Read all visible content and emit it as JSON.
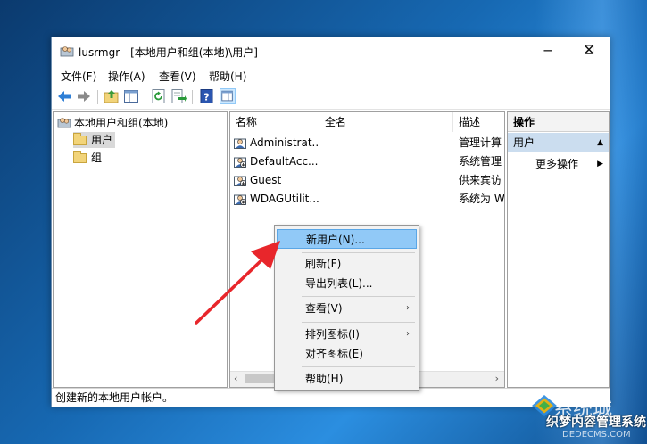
{
  "window": {
    "title": "lusrmgr - [本地用户和组(本地)\\用户]",
    "controls": {
      "minimize": "─",
      "maximize": "☐",
      "close": "✕"
    }
  },
  "menubar": [
    "文件(F)",
    "操作(A)",
    "查看(V)",
    "帮助(H)"
  ],
  "toolbar": [
    "back-arrow-icon",
    "forward-arrow-icon",
    "up-folder-icon",
    "show-hide-tree-icon",
    "refresh-icon",
    "export-list-icon",
    "help-icon",
    "properties-pane-icon"
  ],
  "tree": {
    "root": "本地用户和组(本地)",
    "children": [
      "用户",
      "组"
    ]
  },
  "list": {
    "columns": [
      "名称",
      "全名",
      "描述"
    ],
    "rows": [
      {
        "name": "Administrat...",
        "fullname": "",
        "desc": "管理计算"
      },
      {
        "name": "DefaultAcc...",
        "fullname": "",
        "desc": "系统管理"
      },
      {
        "name": "Guest",
        "fullname": "",
        "desc": "供来宾访"
      },
      {
        "name": "WDAGUtilit...",
        "fullname": "",
        "desc": "系统为 W"
      }
    ]
  },
  "actions": {
    "header": "操作",
    "section": "用户",
    "more": "更多操作"
  },
  "status": "创建新的本地用户帐户。",
  "context_menu": {
    "items": [
      "新用户(N)...",
      "刷新(F)",
      "导出列表(L)...",
      "查看(V)",
      "排列图标(I)",
      "对齐图标(E)",
      "帮助(H)"
    ],
    "submenu_arrow": "›"
  },
  "watermark": {
    "line1": "系统城",
    "line2": "织梦内容管理系统",
    "line3": "DEDECMS.COM"
  },
  "colors": {
    "selection": "#cce8ff",
    "highlight": "#91c9f7",
    "arrow": "#e8262b",
    "action_section": "#cbddef"
  }
}
